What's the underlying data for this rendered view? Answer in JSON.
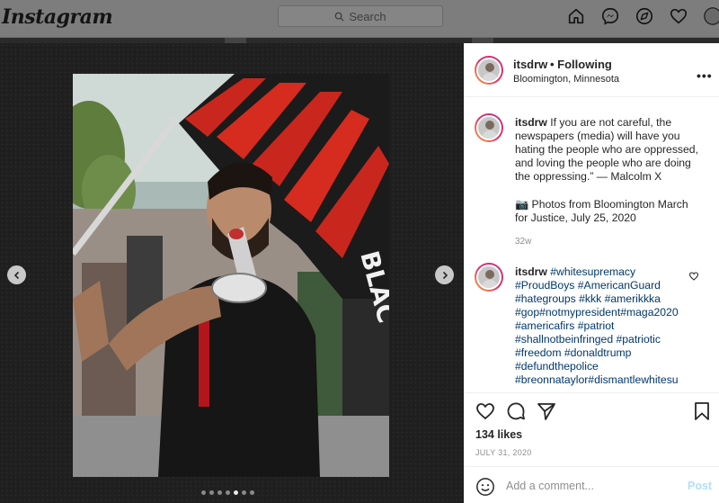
{
  "topbar": {
    "logo": "Instagram",
    "search_placeholder": "Search",
    "icons": [
      "home-icon",
      "messenger-icon",
      "explore-icon",
      "activity-heart-icon",
      "profile-avatar-icon"
    ]
  },
  "post": {
    "username": "itsdrw",
    "follow_status": "Following",
    "location": "Bloomington, Minnesota",
    "more": "•••",
    "caption_username": "itsdrw",
    "caption_line1": " If you are not careful, the newspapers (media) will have you hating the people who are oppressed, and loving the people who are doing the oppressing.” — Malcolm X",
    "caption_line2": "📷 Photos from Bloomington March for Justice, July 25, 2020",
    "caption_time": "32w",
    "comment_username": "itsdrw",
    "hashtags": "#whitesupremacy #ProudBoys #AmericanGuard #hategroups #kkk #amerikkka #gop#notmypresident#maga2020 #americafirs #patriot #shallnotbeinfringed #patriotic #freedom #donaldtrump #defundthepolice #breonnataylor#dismantlewhitesu",
    "likes": "134 likes",
    "date": "JULY 31, 2020",
    "comment_placeholder": "Add a comment...",
    "post_label": "Post"
  },
  "carousel": {
    "total_slides": 7,
    "active_slide": 5
  },
  "colors": {
    "accent_link": "#00376b",
    "post_disabled": "#b2dffc",
    "flag_red": "#d62b1f"
  }
}
